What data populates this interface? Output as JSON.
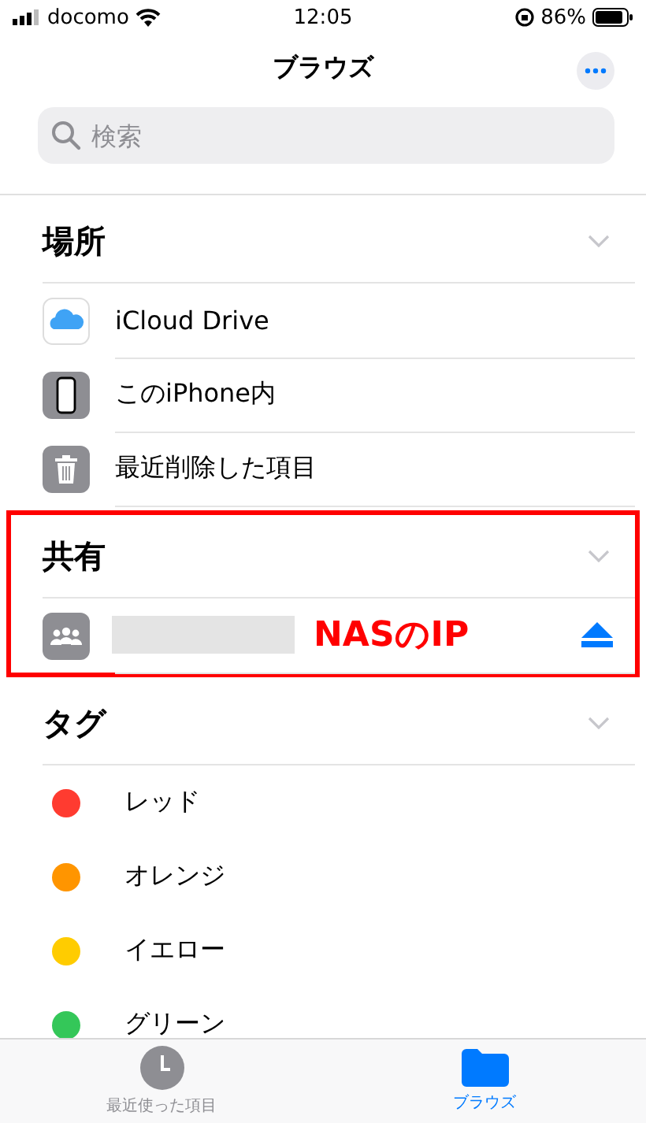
{
  "status_bar": {
    "carrier": "docomo",
    "time": "12:05",
    "battery": "86%"
  },
  "nav": {
    "title": "ブラウズ"
  },
  "search": {
    "placeholder": "検索"
  },
  "sections": [
    {
      "title": "場所",
      "highlighted": false,
      "items": [
        {
          "kind": "icloud",
          "label": "iCloud Drive"
        },
        {
          "kind": "iphone",
          "label": "このiPhone内"
        },
        {
          "kind": "trash",
          "label": "最近削除した項目"
        }
      ]
    },
    {
      "title": "共有",
      "highlighted": true,
      "items": [
        {
          "kind": "server",
          "annotation": "NASのIP"
        }
      ]
    },
    {
      "title": "タグ",
      "highlighted": false,
      "items": [
        {
          "kind": "tag",
          "label": "レッド",
          "color": "#ff3b30"
        },
        {
          "kind": "tag",
          "label": "オレンジ",
          "color": "#ff9500"
        },
        {
          "kind": "tag",
          "label": "イエロー",
          "color": "#ffcc00"
        },
        {
          "kind": "tag",
          "label": "グリーン",
          "color": "#34c759"
        }
      ]
    }
  ],
  "tab_bar": [
    {
      "label": "最近使った項目",
      "kind": "recent",
      "selected": false
    },
    {
      "label": "ブラウズ",
      "kind": "browse",
      "selected": true
    }
  ]
}
